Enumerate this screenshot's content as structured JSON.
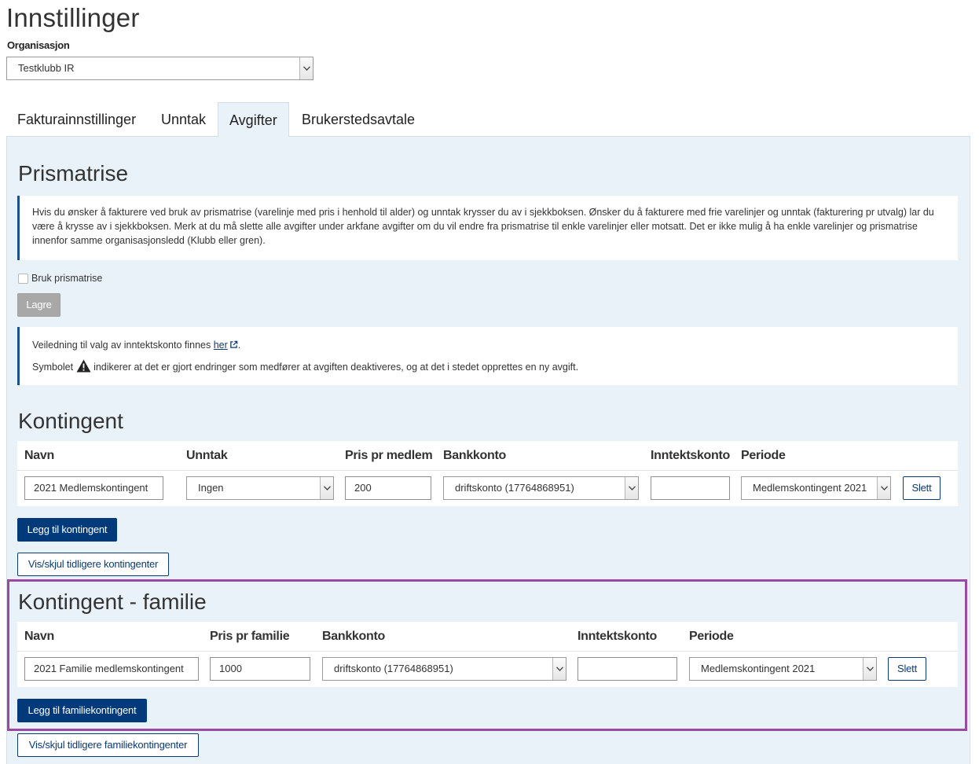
{
  "page": {
    "title": "Innstillinger"
  },
  "organization": {
    "label": "Organisasjon",
    "selected": "Testklubb IR"
  },
  "tabs": [
    {
      "label": "Fakturainnstillinger"
    },
    {
      "label": "Unntak"
    },
    {
      "label": "Avgifter",
      "active": true
    },
    {
      "label": "Brukerstedsavtale"
    }
  ],
  "prismatrise": {
    "title": "Prismatrise",
    "info": "Hvis du ønsker å fakturere ved bruk av prismatrise (varelinje med pris i henhold til alder) og unntak krysser du av i sjekkboksen. Ønsker du å fakturere med frie varelinjer og unntak (fakturering pr utvalg) lar du være å krysse av i sjekkboksen. Merk at du må slette alle avgifter under arkfane avgifter om du vil endre fra prismatrise til enkle varelinjer eller motsatt. Det er ikke mulig å ha enkle varelinjer og prismatrise innenfor samme organisasjonsledd (Klubb eller gren).",
    "checkbox_label": "Bruk prismatrise",
    "save_label": "Lagre"
  },
  "guide": {
    "line1_prefix": "Veiledning til valg av inntektskonto finnes ",
    "line1_link": "her",
    "line1_suffix": ".",
    "line2_prefix": "Symbolet ",
    "line2_suffix": " indikerer at det er gjort endringer som medfører at avgiften deaktiveres, og at det i stedet opprettes en ny avgift."
  },
  "kontingent": {
    "title": "Kontingent",
    "headers": {
      "navn": "Navn",
      "unntak": "Unntak",
      "pris": "Pris pr medlem",
      "bankkonto": "Bankkonto",
      "inntektskonto": "Inntektskonto",
      "periode": "Periode"
    },
    "row": {
      "navn": "2021 Medlemskontingent",
      "unntak": "Ingen",
      "pris": "200",
      "bankkonto": "driftskonto (17764868951)",
      "inntektskonto": "",
      "periode": "Medlemskontingent 2021",
      "delete_label": "Slett"
    },
    "add_label": "Legg til kontingent",
    "toggle_label": "Vis/skjul tidligere kontingenter"
  },
  "familie": {
    "title": "Kontingent - familie",
    "headers": {
      "navn": "Navn",
      "pris": "Pris pr familie",
      "bankkonto": "Bankkonto",
      "inntektskonto": "Inntektskonto",
      "periode": "Periode"
    },
    "row": {
      "navn": "2021 Familie medlemskontingent",
      "pris": "1000",
      "bankkonto": "driftskonto (17764868951)",
      "inntektskonto": "",
      "periode": "Medlemskontingent 2021",
      "delete_label": "Slett"
    },
    "add_label": "Legg til familiekontingent",
    "toggle_label": "Vis/skjul tidligere familiekontingenter"
  },
  "colors": {
    "primary": "#003a7a",
    "panel_bg": "#eaf2f9",
    "highlight": "#9b4aa2"
  }
}
